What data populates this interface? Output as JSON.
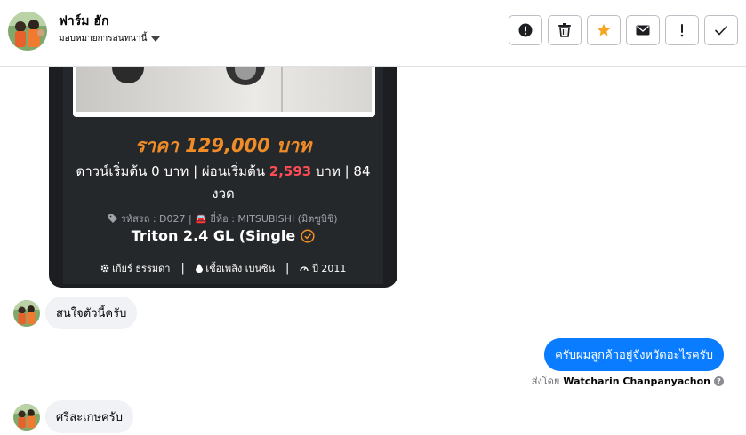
{
  "header": {
    "name": "ฟาร์ม ฮัก",
    "assign_label": "มอบหมายการสนทนานี้",
    "actions": [
      {
        "icon": "exclamation-circle-icon",
        "label": "Mark as spam"
      },
      {
        "icon": "trash-icon",
        "label": "Delete"
      },
      {
        "icon": "star-icon",
        "label": "Star",
        "color": "#f5a623"
      },
      {
        "icon": "envelope-icon",
        "label": "Mark as unread"
      },
      {
        "icon": "exclamation-icon",
        "label": "Follow up"
      },
      {
        "icon": "check-icon",
        "label": "Done"
      }
    ]
  },
  "card": {
    "price": "ราคา 129,000 บาท",
    "down_line_a": "ดาวน์เริ่มต้น 0 บาท | ผ่อนเริ่มต้น ",
    "installment": "2,593",
    "down_line_b": " บาท | 84 งวด",
    "meta": "รหัสรถ : D027 | 🚘 ยี่ห้อ : MITSUBISHI (มิตซูบิชิ)",
    "model": "Triton 2.4 GL (Single",
    "gear": "เกียร์ ธรรมดา",
    "fuel": "เชื้อเพลิง เบนซิน",
    "year": "ปี 2011",
    "price_color": "#f08c28",
    "installment_color": "#ff4b55"
  },
  "messages": [
    {
      "direction": "in",
      "text": "สนใจตัวนี้ครับ"
    },
    {
      "direction": "out",
      "text": "ครับผมลูกค้าอยู่จังหวัดอะไรครับ"
    },
    {
      "direction": "in",
      "text": "ศรีสะเกษครับ"
    }
  ],
  "sent_by": {
    "prefix": "ส่งโดย",
    "name": "Watcharin Chanpanyachon"
  }
}
